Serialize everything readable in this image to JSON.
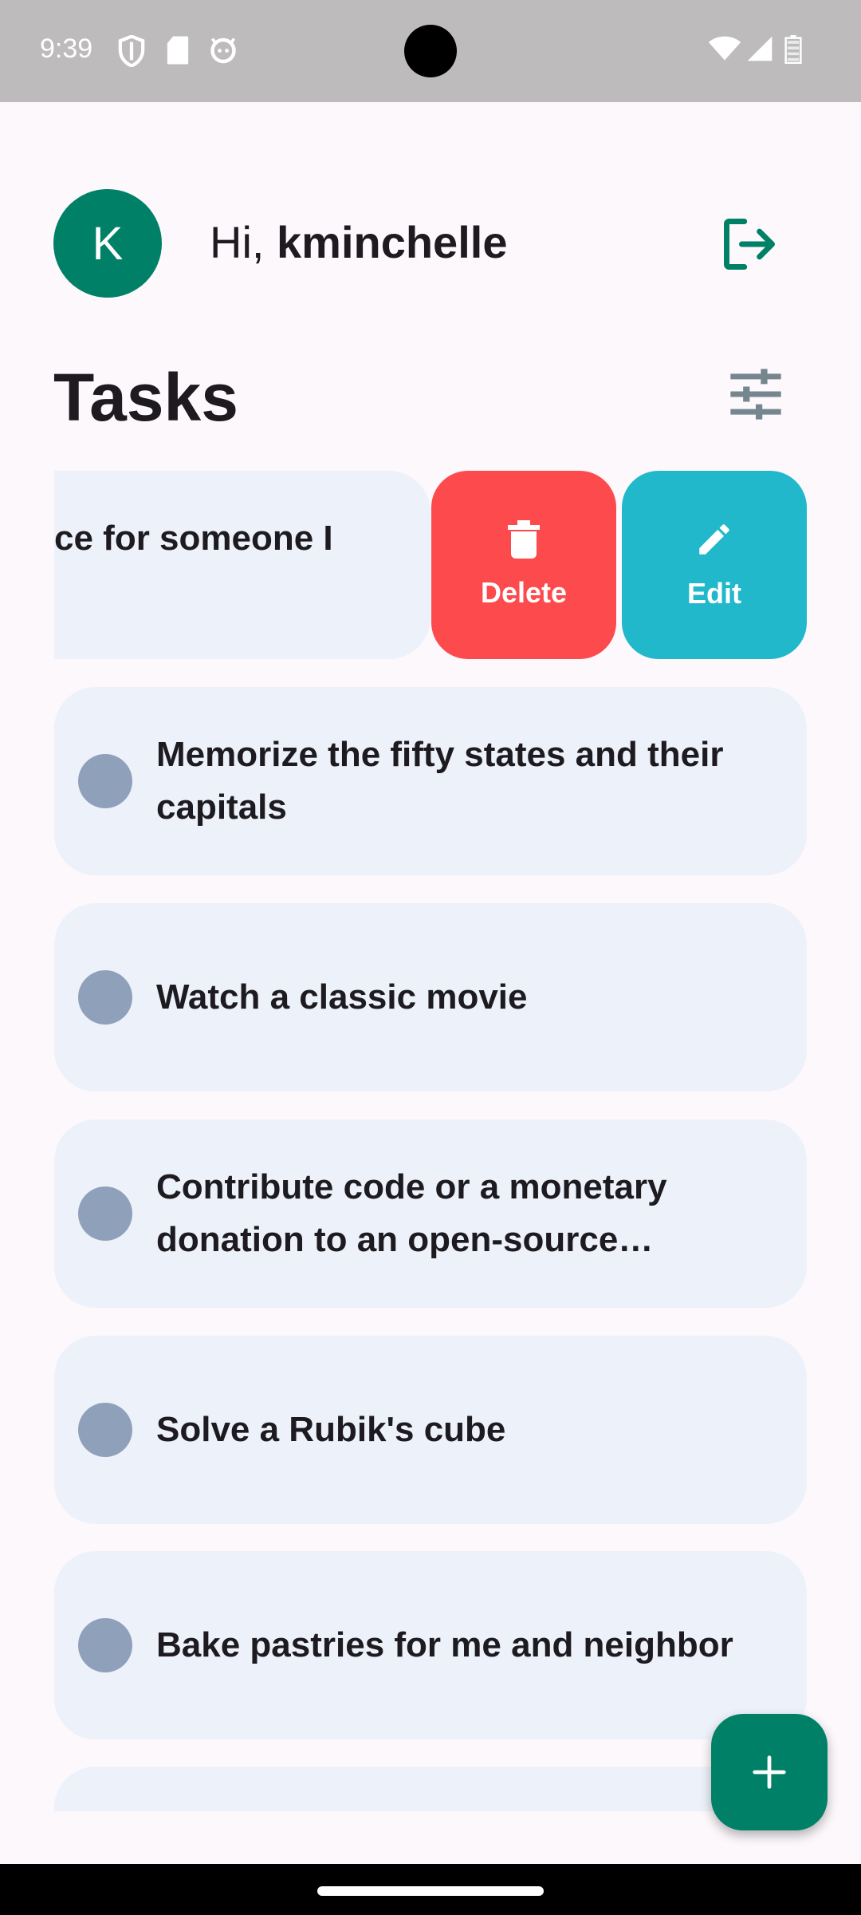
{
  "status_bar": {
    "time": "9:39",
    "icons": [
      "shield-icon",
      "sd-card-icon",
      "android-icon",
      "wifi-icon",
      "signal-icon",
      "battery-icon"
    ]
  },
  "header": {
    "avatar_letter": "K",
    "greeting_prefix": "Hi, ",
    "username": "kminchelle",
    "logout_icon": "logout-icon"
  },
  "page_title": "Tasks",
  "filter_icon": "tune-icon",
  "swiped_task": {
    "visible_text": "ce for someone I",
    "actions": {
      "delete_label": "Delete",
      "edit_label": "Edit"
    }
  },
  "tasks": [
    {
      "text": "Memorize the fifty states and their capitals"
    },
    {
      "text": "Watch a classic movie"
    },
    {
      "text": "Contribute code or a monetary donation to an open-source software project"
    },
    {
      "text": "Solve a Rubik's cube"
    },
    {
      "text": "Bake pastries for me and neighbor"
    }
  ],
  "fab_icon": "add-icon",
  "colors": {
    "primary": "#008066",
    "delete": "#fd4a4d",
    "edit": "#21b8cc",
    "card": "#edf1f9",
    "check": "#8fa0ba"
  }
}
